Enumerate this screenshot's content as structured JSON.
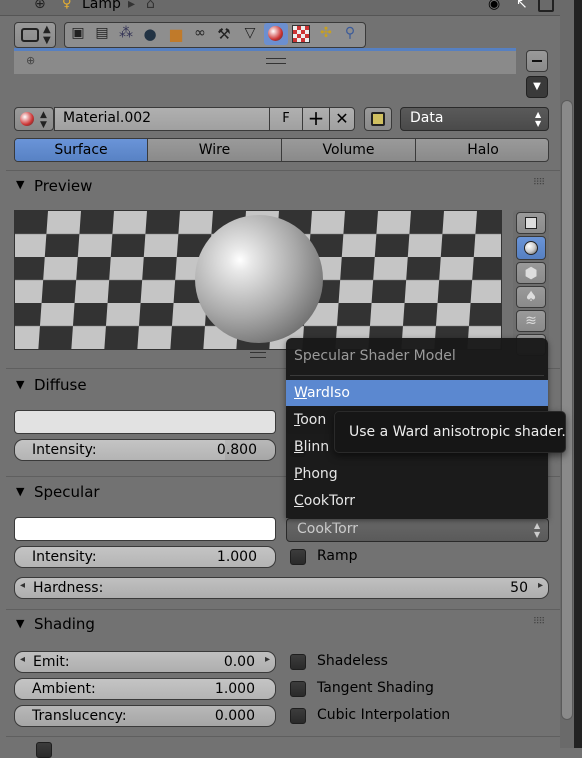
{
  "header": {
    "tab_label": "Lamp"
  },
  "material": {
    "slot_name": "Material.002",
    "fake_user": "F",
    "link_value": "Data"
  },
  "tabs": [
    "Surface",
    "Wire",
    "Volume",
    "Halo"
  ],
  "preview": {
    "title": "Preview"
  },
  "diffuse": {
    "title": "Diffuse",
    "intensity_label": "Intensity:",
    "intensity_value": "0.800"
  },
  "specular": {
    "title": "Specular",
    "intensity_label": "Intensity:",
    "intensity_value": "1.000",
    "shader_value": "CookTorr",
    "ramp_label": "Ramp",
    "hardness_label": "Hardness:",
    "hardness_value": "50"
  },
  "shading": {
    "title": "Shading",
    "emit_label": "Emit:",
    "emit_value": "0.00",
    "ambient_label": "Ambient:",
    "ambient_value": "1.000",
    "translucency_label": "Translucency:",
    "translucency_value": "0.000",
    "shadeless_label": "Shadeless",
    "tangent_label": "Tangent Shading",
    "cubic_label": "Cubic Interpolation"
  },
  "dropdown": {
    "title": "Specular Shader Model",
    "items": [
      {
        "first": "W",
        "rest": "ardIso"
      },
      {
        "first": "T",
        "rest": "oon"
      },
      {
        "first": "B",
        "rest": "linn"
      },
      {
        "first": "P",
        "rest": "hong"
      },
      {
        "first": "C",
        "rest": "ookTorr"
      }
    ],
    "highlighted_index": 0
  },
  "tooltip": {
    "text": "Use a Ward anisotropic shader."
  },
  "colors": {
    "accent": "#5680c2",
    "panel": "#727272",
    "menu_bg": "#1b1b1b",
    "highlight": "#5b88d0"
  }
}
